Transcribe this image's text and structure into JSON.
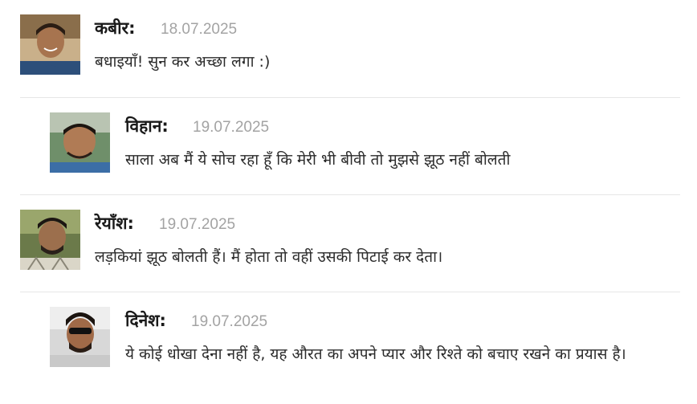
{
  "comments": [
    {
      "author": "कबीर:",
      "date": "18.07.2025",
      "text": "बधाइयाँ! सुन कर अच्छा लगा :)",
      "avatar_icon": "user-photo-avatar"
    },
    {
      "author": "विहान:",
      "date": "19.07.2025",
      "text": "साला अब मैं ये सोच रहा हूँ कि मेरी भी बीवी तो मुझसे झूठ नहीं बोलती",
      "avatar_icon": "user-photo-avatar"
    },
    {
      "author": "रेयाँश:",
      "date": "19.07.2025",
      "text": "लड़कियां झूठ बोलती हैं। मैं होता तो वहीं उसकी पिटाई कर देता।",
      "avatar_icon": "user-photo-avatar"
    },
    {
      "author": "दिनेश:",
      "date": "19.07.2025",
      "text": "ये कोई धोखा देना नहीं है, यह औरत का अपने प्यार और रिश्ते को बचाए रखने का प्रयास है।",
      "avatar_icon": "user-photo-avatar"
    }
  ],
  "colors": {
    "author": "#1a1a1a",
    "date": "#a3a3a3",
    "text": "#2b2b2b",
    "divider": "#e6e6e6"
  }
}
